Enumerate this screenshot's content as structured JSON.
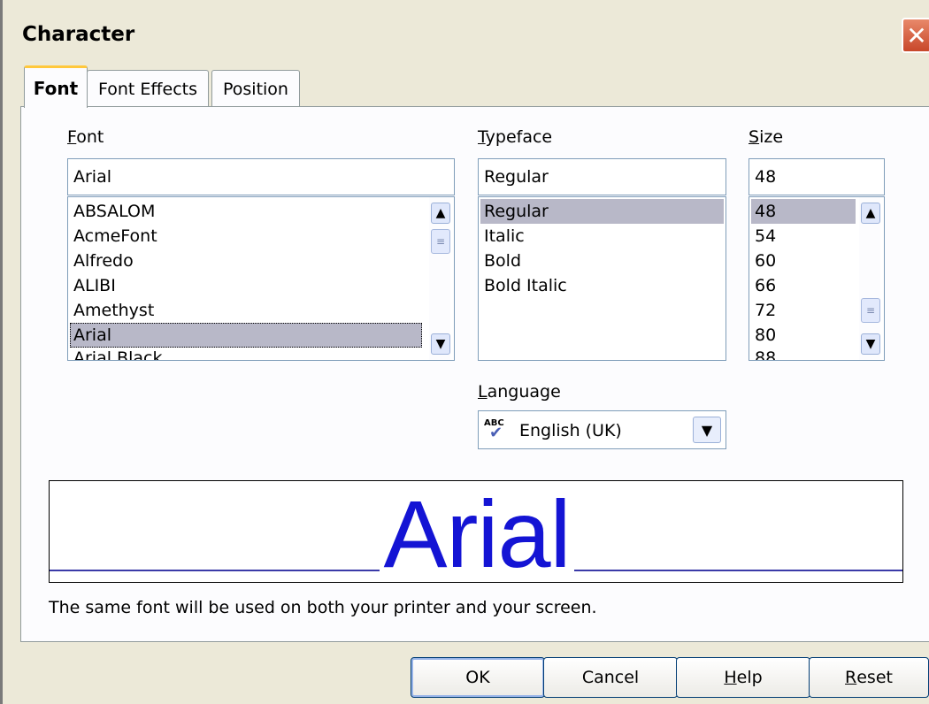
{
  "window": {
    "title": "Character",
    "close_glyph": "✕"
  },
  "tabs": [
    {
      "label": "Font",
      "active": true
    },
    {
      "label": "Font Effects",
      "active": false
    },
    {
      "label": "Position",
      "active": false
    }
  ],
  "font": {
    "label_mnemonic": "F",
    "label_rest": "ont",
    "value": "Arial",
    "items": [
      "ABSALOM",
      "AcmeFont",
      "Alfredo",
      "ALIBI",
      "Amethyst",
      "Arial",
      "Arial Black"
    ],
    "selected": "Arial"
  },
  "typeface": {
    "label_mnemonic": "T",
    "label_rest": "ypeface",
    "value": "Regular",
    "items": [
      "Regular",
      "Italic",
      "Bold",
      "Bold Italic"
    ],
    "selected": "Regular"
  },
  "size": {
    "label_mnemonic": "S",
    "label_rest": "ize",
    "value": "48",
    "items": [
      "48",
      "54",
      "60",
      "66",
      "72",
      "80",
      "88"
    ],
    "selected": "48"
  },
  "language": {
    "label_mnemonic": "L",
    "label_rest": "anguage",
    "value": "English (UK)",
    "icon_text": "ABC"
  },
  "preview": {
    "text": "Arial",
    "text_color": "#1414d4"
  },
  "note": "The same font will be used on both your printer and your screen.",
  "buttons": {
    "ok": "OK",
    "cancel": "Cancel",
    "help_mnemonic": "H",
    "help_rest": "elp",
    "reset_mnemonic": "R",
    "reset_rest": "eset"
  },
  "icons": {
    "scroll_up": "▲",
    "scroll_down": "▼",
    "thumb_grip": "≡",
    "dropdown": "▼",
    "check": "✔"
  }
}
